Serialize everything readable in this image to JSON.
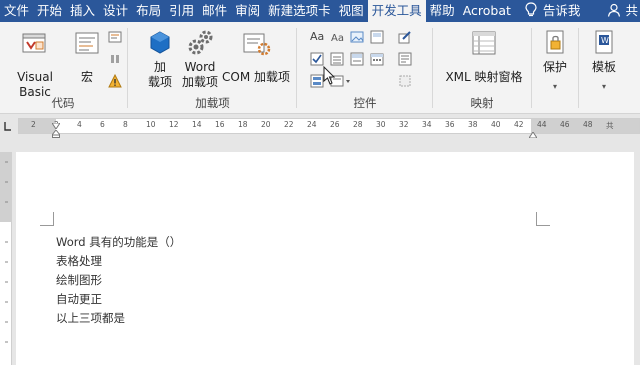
{
  "tabs": [
    {
      "label": "文件",
      "active": false
    },
    {
      "label": "开始",
      "active": false
    },
    {
      "label": "插入",
      "active": false
    },
    {
      "label": "设计",
      "active": false
    },
    {
      "label": "布局",
      "active": false
    },
    {
      "label": "引用",
      "active": false
    },
    {
      "label": "邮件",
      "active": false
    },
    {
      "label": "审阅",
      "active": false
    },
    {
      "label": "新建选项卡",
      "active": false
    },
    {
      "label": "视图",
      "active": false
    },
    {
      "label": "开发工具",
      "active": true
    },
    {
      "label": "帮助",
      "active": false
    },
    {
      "label": "Acrobat",
      "active": false
    }
  ],
  "tell_me": "告诉我",
  "share": "共",
  "ribbon": {
    "code": {
      "label": "代码",
      "visual_basic": "Visual Basic",
      "macros": "宏"
    },
    "addins": {
      "label": "加载项",
      "addins_line1": "加",
      "addins_line2": "载项",
      "word_line1": "Word",
      "word_line2": "加载项",
      "com": "COM 加载项"
    },
    "controls": {
      "label": "控件",
      "aa_icon": "Aa"
    },
    "mapping": {
      "label": "映射",
      "xml": "XML 映射窗格"
    },
    "protect": {
      "label": "保护"
    },
    "templates": {
      "label": "模板"
    }
  },
  "ruler_numbers": [
    "2",
    "2",
    "4",
    "6",
    "8",
    "10",
    "12",
    "14",
    "16",
    "18",
    "20",
    "22",
    "24",
    "26",
    "28",
    "30",
    "32",
    "34",
    "36",
    "38",
    "40",
    "42",
    "44",
    "46",
    "48",
    "共"
  ],
  "document": {
    "lines": [
      "Word 具有的功能是（）",
      "表格处理",
      "绘制图形",
      "自动更正",
      "以上三项都是"
    ]
  },
  "colors": {
    "tabbar": "#2b579a",
    "ribbon": "#f3f3f3",
    "workspace": "#e6e6e6"
  }
}
